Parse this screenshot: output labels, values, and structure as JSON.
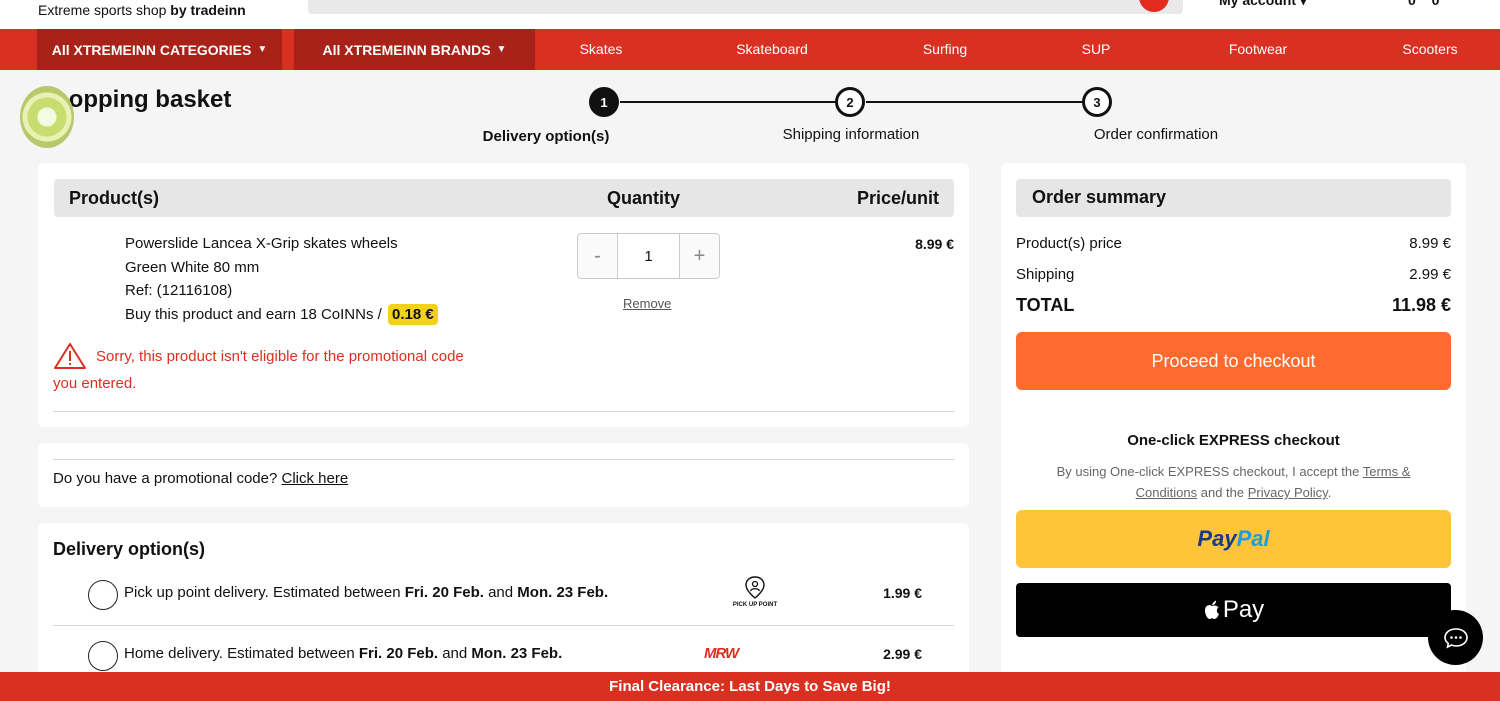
{
  "header": {
    "tagline_prefix": "Extreme sports shop",
    "tagline_brand": "by tradeinn",
    "account_label": "My account",
    "cart_counts": "0 0"
  },
  "nav": {
    "categories_label": "All XTREMEINN CATEGORIES",
    "brands_label": "All XTREMEINN BRANDS",
    "links": [
      "Skates",
      "Skateboard",
      "Surfing",
      "SUP",
      "Footwear",
      "Scooters"
    ]
  },
  "page": {
    "title": "Shopping basket"
  },
  "steps": [
    {
      "number": "1",
      "label": "Delivery option(s)",
      "active": true
    },
    {
      "number": "2",
      "label": "Shipping information",
      "active": false
    },
    {
      "number": "3",
      "label": "Order confirmation",
      "active": false
    }
  ],
  "basket": {
    "headers": {
      "product": "Product(s)",
      "quantity": "Quantity",
      "price": "Price/unit"
    },
    "item": {
      "name": "Powerslide Lancea X-Grip skates wheels",
      "variant": "Green White 80 mm",
      "ref": "Ref: (12116108)",
      "coins_text": "Buy this product and earn 18 CoINNs /",
      "coins_value": "0.18 €",
      "quantity": "1",
      "remove_label": "Remove",
      "price": "8.99 €",
      "warning": "Sorry, this product isn't eligible for the promotional code you entered."
    }
  },
  "promo": {
    "question": "Do you have a promotional code?",
    "link": "Click here"
  },
  "delivery": {
    "title": "Delivery option(s)",
    "options": [
      {
        "prefix": "Pick up point delivery. Estimated between",
        "from": "Fri. 20 Feb.",
        "and": "and",
        "to": "Mon. 23 Feb.",
        "price": "1.99 €",
        "carrier": "PICK UP POINT"
      },
      {
        "prefix": "Home delivery. Estimated between",
        "from": "Fri. 20 Feb.",
        "and": "and",
        "to": "Mon. 23 Feb.",
        "price": "2.99 €",
        "carrier": "MRW"
      }
    ]
  },
  "summary": {
    "title": "Order summary",
    "product_price_label": "Product(s) price",
    "product_price": "8.99 €",
    "shipping_label": "Shipping",
    "shipping": "2.99 €",
    "total_label": "TOTAL",
    "total": "11.98 €",
    "checkout_label": "Proceed to checkout",
    "express_title_prefix": "One-click",
    "express_title_bold": "EXPRESS",
    "express_title_suffix": "checkout",
    "express_note_prefix": "By using One-click EXPRESS checkout, I accept the",
    "terms_link": "Terms & Conditions",
    "express_note_and": "and the",
    "privacy_link": "Privacy Policy",
    "express_note_end": ".",
    "paypal_a": "Pay",
    "paypal_b": "Pal",
    "applepay_label": "Pay"
  },
  "banner": {
    "text": "Final Clearance: Last Days to Save Big!"
  },
  "colors": {
    "brand_red": "#d93021",
    "dark_red": "#a8221a",
    "checkout_orange": "#ff6b2f",
    "paypal_yellow": "#ffc439",
    "coin_yellow": "#f2d11a"
  }
}
